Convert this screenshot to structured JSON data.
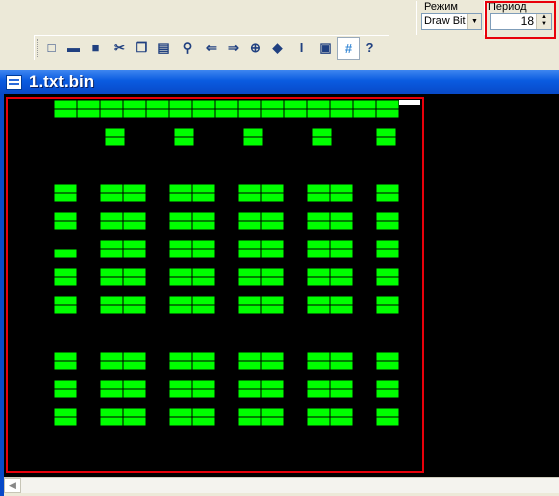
{
  "mode": {
    "label": "Режим",
    "value": "Draw Bit"
  },
  "period": {
    "label": "Период",
    "value": "18"
  },
  "toolbar": [
    {
      "name": "new-file-icon",
      "glyph": "□"
    },
    {
      "name": "open-folder-icon",
      "glyph": "▬"
    },
    {
      "name": "save-icon",
      "glyph": "■"
    },
    {
      "name": "cut-icon",
      "glyph": "✂"
    },
    {
      "name": "copy-icon",
      "glyph": "❐"
    },
    {
      "name": "paste-icon",
      "glyph": "▤"
    },
    {
      "name": "find-icon",
      "glyph": "⚲"
    },
    {
      "name": "back-arrow-icon",
      "glyph": "⇐"
    },
    {
      "name": "forward-arrow-icon",
      "glyph": "⇒"
    },
    {
      "name": "zoom-icon",
      "glyph": "⊕"
    },
    {
      "name": "shape-icon",
      "glyph": "◆"
    },
    {
      "name": "italic-icon",
      "glyph": "I"
    },
    {
      "name": "rect-icon",
      "glyph": "▣"
    },
    {
      "name": "grid-icon",
      "glyph": "#"
    },
    {
      "name": "help-icon",
      "glyph": "?"
    }
  ],
  "window": {
    "title": "1.txt.bin"
  },
  "colors": {
    "bit_on": "#00FF00",
    "bit_off": "#000000",
    "highlight": "#E8000A"
  }
}
